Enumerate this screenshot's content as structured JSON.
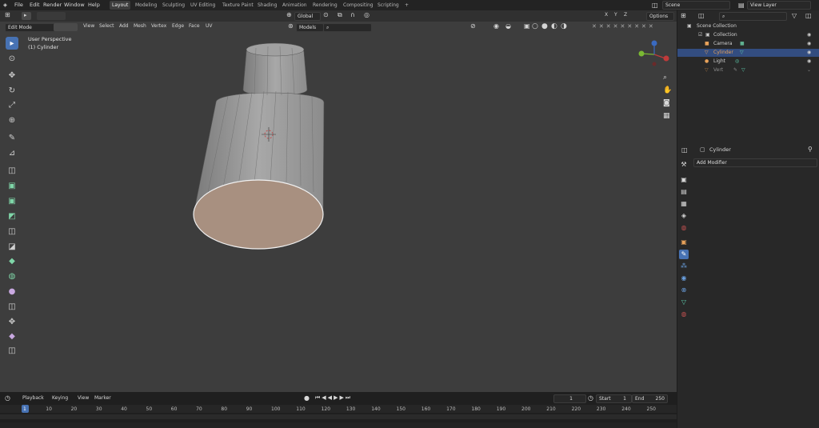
{
  "topbar": {
    "menus": [
      "File",
      "Edit",
      "Render",
      "Window",
      "Help"
    ],
    "workspaces": [
      "Layout",
      "Modeling",
      "Sculpting",
      "UV Editing",
      "Texture Paint",
      "Shading",
      "Animation",
      "Rendering",
      "Compositing",
      "Scripting",
      "+"
    ],
    "active_workspace": "Layout",
    "scene": "Scene",
    "view_layer": "View Layer"
  },
  "viewport_header": {
    "mode": "Edit Mode",
    "menus": [
      "View",
      "Select",
      "Add",
      "Mesh",
      "Vertex",
      "Edge",
      "Face",
      "UV"
    ],
    "transform_orientation": "Global",
    "snap_target": "Models",
    "options": "Options",
    "axes": [
      "X",
      "Y",
      "Z"
    ]
  },
  "viewport": {
    "view_name": "User Perspective",
    "object_name": "(1) Cylinder"
  },
  "outliner": {
    "root": "Scene Collection",
    "items": [
      {
        "label": "Collection",
        "selected": false,
        "color": "#d8d8d8"
      },
      {
        "label": "Camera",
        "selected": false,
        "color": "#d8d8d8"
      },
      {
        "label": "Cylinder",
        "selected": true,
        "color": "#e8a25a"
      },
      {
        "label": "Light",
        "selected": false,
        "color": "#d8d8d8"
      },
      {
        "label": "Vert",
        "selected": false,
        "color": "#8a8a8a"
      }
    ]
  },
  "properties": {
    "object_name": "Cylinder",
    "add_modifier": "Add Modifier"
  },
  "timeline": {
    "menus": [
      "Playback",
      "Keying",
      "View",
      "Marker"
    ],
    "current_frame": "1",
    "start_label": "Start",
    "start": "1",
    "end_label": "End",
    "end": "250",
    "ticks": [
      "1",
      "10",
      "20",
      "30",
      "40",
      "50",
      "60",
      "70",
      "80",
      "90",
      "100",
      "110",
      "120",
      "130",
      "140",
      "150",
      "160",
      "170",
      "180",
      "190",
      "200",
      "210",
      "220",
      "230",
      "240",
      "250"
    ]
  },
  "colors": {
    "accent": "#4772b3",
    "selected_face": "#a89080",
    "mesh": "#9a9a9a"
  }
}
